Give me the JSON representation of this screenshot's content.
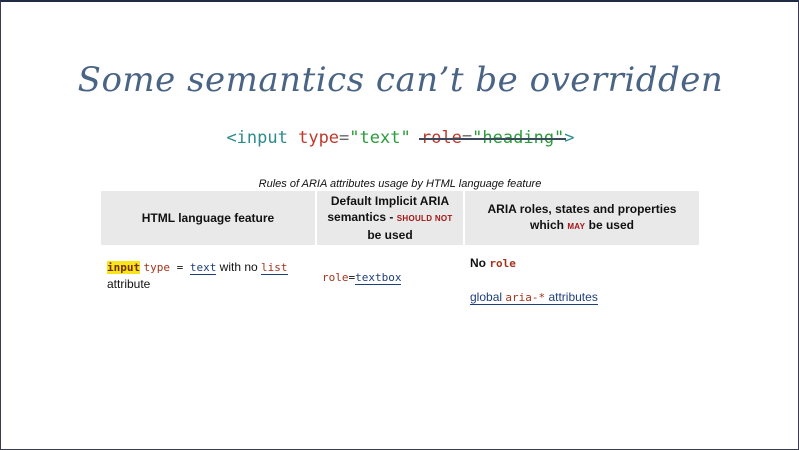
{
  "slide": {
    "title": "Some semantics can’t be overridden",
    "code": {
      "open": "<input ",
      "attr_type": "type",
      "eq": "=",
      "val_text": "\"text\"",
      "space": " ",
      "strike_attr": "role",
      "strike_eq": "=",
      "strike_val": "\"heading\"",
      "close": ">"
    },
    "caption": "Rules of ARIA attributes usage by HTML language feature",
    "table": {
      "headers": {
        "col1": "HTML language feature",
        "col2_a": "Default Implicit ARIA semantics - ",
        "col2_b": "SHOULD NOT",
        "col2_c": " be used",
        "col3_a": "ARIA roles, states and properties which ",
        "col3_b": "MAY",
        "col3_c": " be used"
      },
      "row": {
        "feature_input": "input",
        "feature_type": "type",
        "feature_eq": " = ",
        "feature_text": "text",
        "feature_with": " with no ",
        "feature_list": "list",
        "feature_attribute": "attribute",
        "implicit_role": "role",
        "implicit_eq": "=",
        "implicit_value": "textbox",
        "allowed_no": "No ",
        "allowed_role": "role",
        "allowed_global": "global ",
        "allowed_aria": "aria-*",
        "allowed_attrs": " attributes"
      }
    }
  },
  "colors": {
    "title": "#4a6485",
    "tag": "#2e8b8b",
    "attr": "#c0392b",
    "value": "#2a9d3a",
    "header_bg": "#e9e9e9",
    "highlight": "#f5e51a"
  }
}
